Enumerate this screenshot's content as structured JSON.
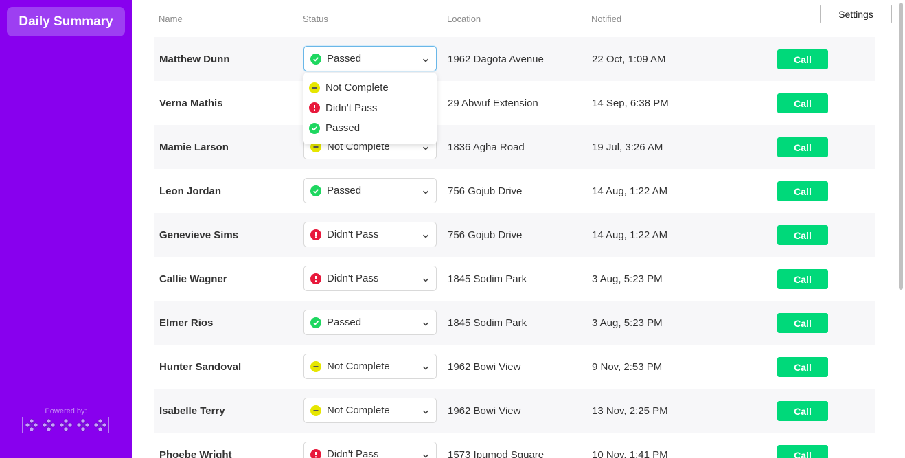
{
  "sidebar": {
    "title": "Daily Summary",
    "powered_by": "Powered by:"
  },
  "header": {
    "columns": [
      "Name",
      "Status",
      "Location",
      "Notified"
    ],
    "settings_label": "Settings"
  },
  "status_options": [
    "Not Complete",
    "Didn't Pass",
    "Passed"
  ],
  "rows": [
    {
      "name": "Matthew Dunn",
      "status": "Passed",
      "status_type": "passed",
      "location": "1962 Dagota Avenue",
      "notified": "22 Oct, 1:09 AM",
      "action": "Call"
    },
    {
      "name": "Verna Mathis",
      "status": "",
      "status_type": "",
      "location": "29 Abwuf Extension",
      "notified": "14 Sep, 6:38 PM",
      "action": "Call"
    },
    {
      "name": "Mamie Larson",
      "status": "Not Complete",
      "status_type": "pending",
      "location": "1836 Agha Road",
      "notified": "19 Jul, 3:26 AM",
      "action": "Call"
    },
    {
      "name": "Leon Jordan",
      "status": "Passed",
      "status_type": "passed",
      "location": "756 Gojub Drive",
      "notified": "14 Aug, 1:22 AM",
      "action": "Call"
    },
    {
      "name": "Genevieve Sims",
      "status": "Didn't Pass",
      "status_type": "failed",
      "location": "756 Gojub Drive",
      "notified": "14 Aug, 1:22 AM",
      "action": "Call"
    },
    {
      "name": "Callie Wagner",
      "status": "Didn't Pass",
      "status_type": "failed",
      "location": "1845 Sodim Park",
      "notified": "3 Aug, 5:23 PM",
      "action": "Call"
    },
    {
      "name": "Elmer Rios",
      "status": "Passed",
      "status_type": "passed",
      "location": "1845 Sodim Park",
      "notified": "3 Aug, 5:23 PM",
      "action": "Call"
    },
    {
      "name": "Hunter Sandoval",
      "status": "Not Complete",
      "status_type": "pending",
      "location": "1962 Bowi View",
      "notified": "9 Nov, 2:53 PM",
      "action": "Call"
    },
    {
      "name": "Isabelle Terry",
      "status": "Not Complete",
      "status_type": "pending",
      "location": "1962 Bowi View",
      "notified": "13 Nov, 2:25 PM",
      "action": "Call"
    },
    {
      "name": "Phoebe Wright",
      "status": "Didn't Pass",
      "status_type": "failed",
      "location": "1573 Ipumod Square",
      "notified": "10 Nov, 1:41 PM",
      "action": "Call"
    }
  ],
  "colors": {
    "sidebar": "#8800ee",
    "brand_button": "#9d3ff2",
    "passed": "#1ed760",
    "failed": "#e8193c",
    "pending": "#e6e600",
    "call_button": "#00d97a"
  }
}
